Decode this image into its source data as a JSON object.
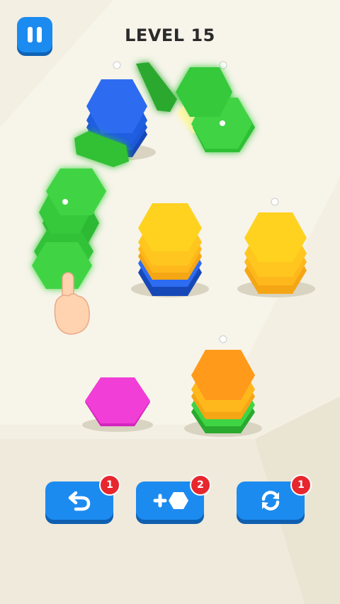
{
  "header": {
    "level_label": "LEVEL 15"
  },
  "toolbar": {
    "undo": {
      "icon": "undo-icon",
      "badge": "1"
    },
    "add_hex": {
      "icon": "add-hexagon-icon",
      "badge": "2"
    },
    "shuffle": {
      "icon": "refresh-icon",
      "badge": "1"
    }
  },
  "colors": {
    "green": "#35c73a",
    "blue": "#1e5fe0",
    "yellow": "#ffd21f",
    "orange": "#ff9a1a",
    "magenta": "#f03ed6",
    "button": "#1c8bf0",
    "badge": "#e8262e"
  }
}
